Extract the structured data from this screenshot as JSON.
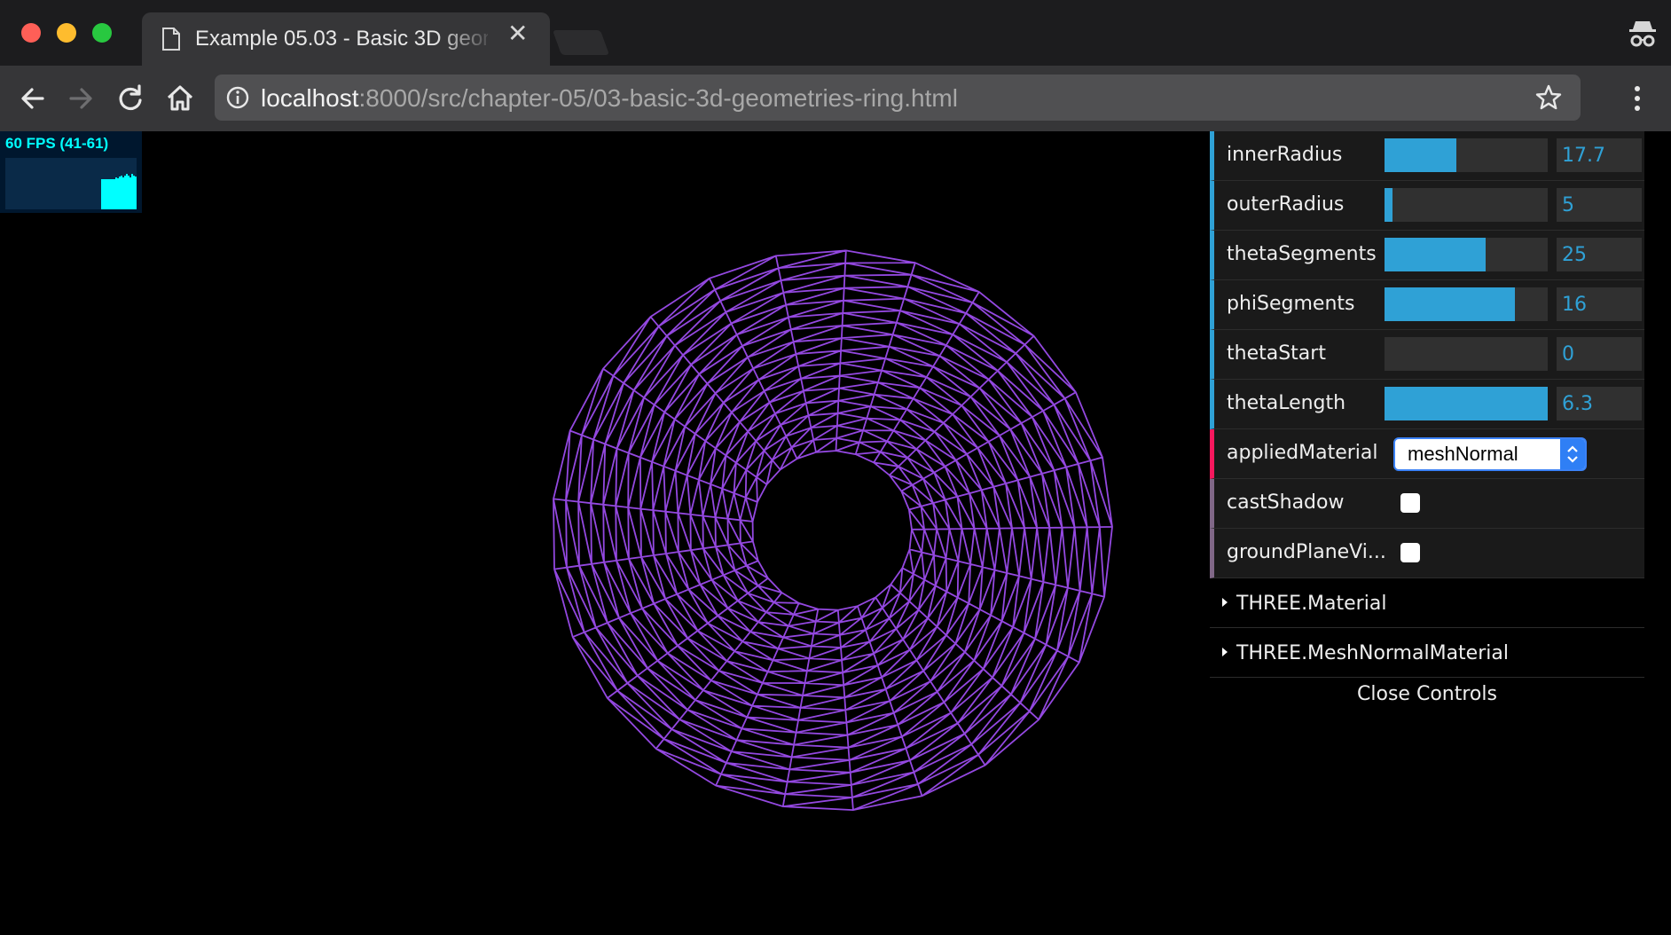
{
  "browser": {
    "tab_title": "Example 05.03 - Basic 3D geometries - Ring",
    "url_host": "localhost",
    "url_path": ":8000/src/chapter-05/03-basic-3d-geometries-ring.html",
    "close_tab_glyph": "✕"
  },
  "stats": {
    "fps_text": "60 FPS (41-61)",
    "history_fraction": [
      0.2,
      0.2,
      0.25,
      0.3,
      0.8,
      0.85,
      0.9,
      0.88,
      0.92,
      0.95,
      0.9,
      0.95,
      1.0,
      0.95,
      0.9,
      1.0,
      0.95,
      0.92
    ]
  },
  "controls": {
    "rows": [
      {
        "label": "innerRadius",
        "value": "17.7",
        "fill": 0.44
      },
      {
        "label": "outerRadius",
        "value": "5",
        "fill": 0.05
      },
      {
        "label": "thetaSegments",
        "value": "25",
        "fill": 0.62
      },
      {
        "label": "phiSegments",
        "value": "16",
        "fill": 0.8
      },
      {
        "label": "thetaStart",
        "value": "0",
        "fill": 0.0
      },
      {
        "label": "thetaLength",
        "value": "6.3",
        "fill": 1.0
      }
    ],
    "applied_material_label": "appliedMaterial",
    "applied_material_value": "meshNormal",
    "cast_shadow_label": "castShadow",
    "ground_plane_label": "groundPlaneVi...",
    "folder1": "THREE.Material",
    "folder2": "THREE.MeshNormalMaterial",
    "close_controls": "Close Controls"
  },
  "colors": {
    "mesh": "#9348e0",
    "slider_fill": "#2fa1d6",
    "stats_text": "#00ffff"
  }
}
